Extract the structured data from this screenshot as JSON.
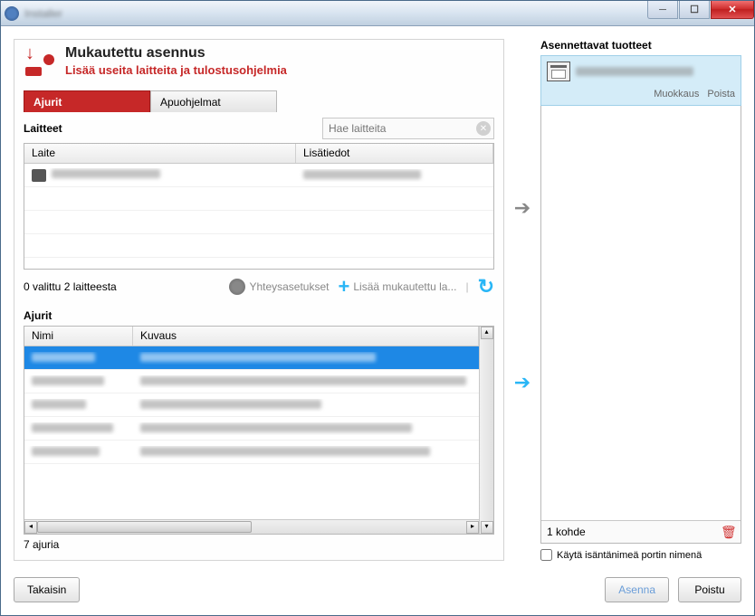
{
  "window": {
    "title": "Installer"
  },
  "header": {
    "title": "Mukautettu asennus",
    "subtitle": "Lisää useita laitteita ja tulostusohjelmia"
  },
  "tabs": {
    "drivers": "Ajurit",
    "utilities": "Apuohjelmat"
  },
  "devices": {
    "section_label": "Laitteet",
    "search_placeholder": "Hae laitteita",
    "col_device": "Laite",
    "col_info": "Lisätiedot",
    "rows": [
      {
        "name": "",
        "info": ""
      }
    ],
    "status": "0 valittu 2 laitteesta"
  },
  "actions": {
    "connection": "Yhteysasetukset",
    "add_custom": "Lisää mukautettu la...",
    "refresh": ""
  },
  "drivers": {
    "section_label": "Ajurit",
    "col_name": "Nimi",
    "col_desc": "Kuvaus",
    "rows": [
      {
        "name": "",
        "desc": "",
        "selected": true
      },
      {
        "name": "",
        "desc": ""
      },
      {
        "name": "",
        "desc": ""
      },
      {
        "name": "",
        "desc": ""
      },
      {
        "name": "",
        "desc": ""
      }
    ],
    "count": "7 ajuria"
  },
  "products": {
    "section_label": "Asennettavat tuotteet",
    "item_name": "",
    "edit": "Muokkaus",
    "delete": "Poista",
    "footer_count": "1 kohde"
  },
  "checkbox": {
    "label": "Käytä isäntänimeä portin nimenä"
  },
  "buttons": {
    "back": "Takaisin",
    "install": "Asenna",
    "exit": "Poistu"
  }
}
